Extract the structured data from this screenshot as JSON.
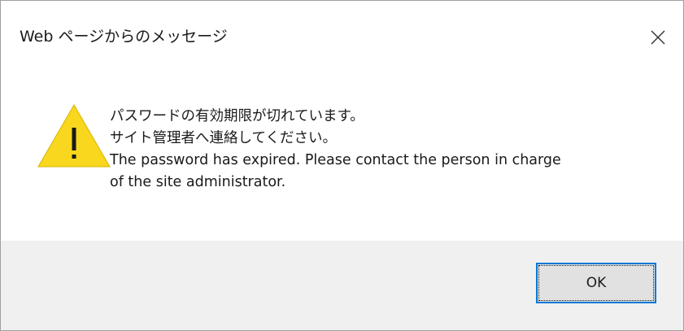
{
  "dialog": {
    "title": "Web ページからのメッセージ",
    "close_icon": "close-icon",
    "icon": "warning-icon",
    "message_lines": [
      "パスワードの有効期限が切れています。",
      "サイト管理者へ連絡してください。",
      "The password has expired. Please contact the person in charge",
      "of the site administrator."
    ],
    "ok_label": "OK"
  },
  "colors": {
    "warning_fill": "#f8d71e",
    "warning_mark": "#1a1a1a",
    "footer_bg": "#f0f0f0",
    "focus_border": "#0078d7",
    "button_bg": "#e1e1e1"
  }
}
